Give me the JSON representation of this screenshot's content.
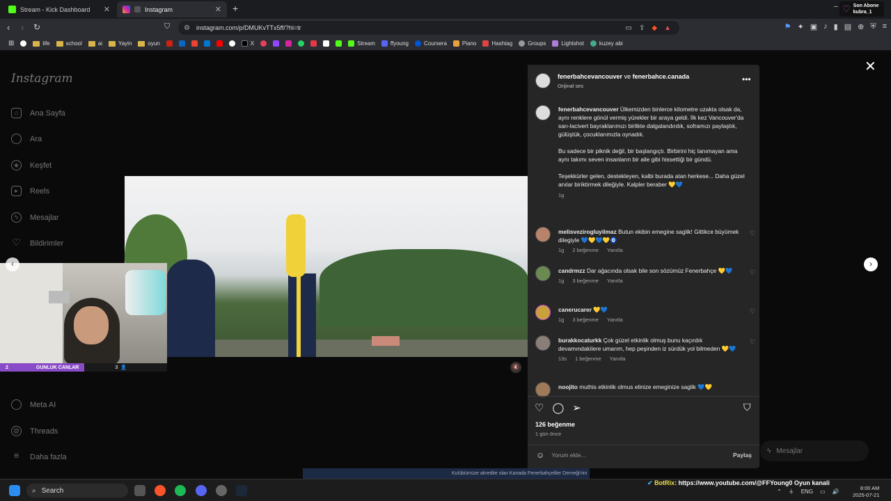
{
  "browser": {
    "tabs": [
      {
        "label": "Stream - Kick Dashboard"
      },
      {
        "label": "Instagram"
      }
    ],
    "url": "instagram.com/p/DMUKvTTx5ff/?hl=tr",
    "notification": {
      "line1": "Son Abone",
      "line2": "kubra_1"
    },
    "bookmarks": [
      {
        "label": "life",
        "type": "folder"
      },
      {
        "label": "school",
        "type": "folder"
      },
      {
        "label": "ai",
        "type": "folder"
      },
      {
        "label": "Yayin",
        "type": "folder"
      },
      {
        "label": "oyun",
        "type": "folder"
      },
      {
        "label": "X",
        "type": "site",
        "color": "#000000"
      },
      {
        "label": "Stream",
        "type": "site",
        "color": "#53fc18"
      },
      {
        "label": "ffyoung",
        "type": "site",
        "color": "#5865f2"
      },
      {
        "label": "Coursera",
        "type": "site",
        "color": "#0056d2"
      },
      {
        "label": "Piano",
        "type": "site",
        "color": "#e8a23a"
      },
      {
        "label": "Hashtag",
        "type": "site",
        "color": "#d44"
      },
      {
        "label": "Groups",
        "type": "site",
        "color": "#999"
      },
      {
        "label": "Lightshot",
        "type": "site",
        "color": "#b07cd8"
      },
      {
        "label": "kuzey abi",
        "type": "site",
        "color": "#4a8"
      }
    ]
  },
  "instagram": {
    "logo": "Instagram",
    "nav": [
      {
        "label": "Ana Sayfa",
        "icon": "home-icon"
      },
      {
        "label": "Ara",
        "icon": "search-icon"
      },
      {
        "label": "Keşfet",
        "icon": "compass-icon"
      },
      {
        "label": "Reels",
        "icon": "reels-icon"
      },
      {
        "label": "Mesajlar",
        "icon": "messenger-icon"
      },
      {
        "label": "Bildirimler",
        "icon": "heart-icon"
      }
    ],
    "nav_bottom": [
      {
        "label": "Meta AI",
        "icon": "meta-ai-icon"
      },
      {
        "label": "Threads",
        "icon": "threads-icon"
      },
      {
        "label": "Daha fazla",
        "icon": "menu-icon"
      }
    ],
    "post": {
      "author1": "fenerbahcevancouver",
      "connector": "ve",
      "author2": "fenerbahce.canada",
      "audio": "Orijinal ses",
      "caption_user": "fenerbahcevancouver",
      "caption_p1": "Ülkemizden binlerce kilometre uzakta olsak da, aynı renklere gönül vermiş yürekler bir araya geldi. İlk kez Vancouver'da sarı-lacivert bayraklarımızı birlikte dalgalandırdık, soframızı paylaştık, gülüştük, çocuklarımızla oynadık.",
      "caption_p2": "Bu sadece bir piknik değil, bir başlangıçtı. Birbirini hiç tanımayan ama aynı takımı seven insanların bir aile gibi hissettiği bir gündü.",
      "caption_p3": "Teşekkürler gelen, destekleyen, kalbi burada atan herkese... Daha güzel anılar biriktirmek dileğiyle. Kalpler beraber 💛💙",
      "caption_time": "1g",
      "comments": [
        {
          "user": "melisvezirogluyilmaz",
          "text": "Butun ekibin emegine saglik! Gittikce büyümek dilegiyle 💙💛💙💛🧿",
          "time": "1g",
          "likes": "2 beğenme",
          "reply": "Yanıtla",
          "avatar_color": "#b9826a"
        },
        {
          "user": "candrmzz",
          "text": "Dar ağacında olsak bile son sözümüz Fenerbahçe 💛💙",
          "time": "1g",
          "likes": "3 beğenme",
          "reply": "Yanıtla",
          "avatar_color": "#6b8a52"
        },
        {
          "user": "canerucarer",
          "text": "💛💙",
          "time": "1g",
          "likes": "3 beğenme",
          "reply": "Yanıtla",
          "avatar_color": "#c9a03c"
        },
        {
          "user": "burakkocaturkk",
          "text": "Çok güzel etkinlik olmuş bunu kaçırdık devamındakilere umarım, hep peşinden iz sürdük yol bilmeden 💛💙",
          "time": "13s",
          "likes": "1 beğenme",
          "reply": "Yanıtla",
          "avatar_color": "#8a7f78"
        },
        {
          "user": "noojito",
          "text": "muthis etkinlik olmus elinize emeginize saglik 💙💛",
          "time": "",
          "likes": "",
          "reply": "",
          "avatar_color": "#a07a58"
        }
      ],
      "likes": "126 beğenme",
      "ago": "1 gün önce",
      "comment_placeholder": "Yorum ekle...",
      "share": "Paylaş"
    },
    "messages_pill": "Mesajlar"
  },
  "stream_overlay": {
    "bar_left": "2",
    "bar_title": "GUNLUK CANLAR",
    "bar_right": "3"
  },
  "ticker": "Kulübümüze akredite olan Kanada Fenerbahçeliler Derneği'nin",
  "taskbar": {
    "search": "Search",
    "botrix_name": "BotRix",
    "botrix_msg": ": https://www.youtube.com/@FFYoung0 Oyun kanali",
    "lang": "ENG",
    "time": "8:00 AM",
    "date": "2025-07-21"
  }
}
